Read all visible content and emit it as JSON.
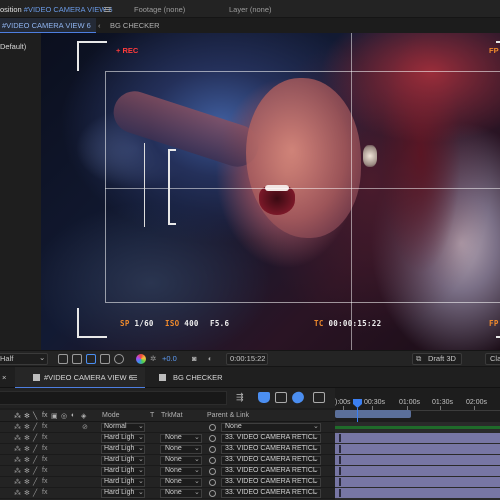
{
  "top_tabs": {
    "composition_prefix": "osition",
    "composition_name": "#VIDEO CAMERA VIEW 6",
    "footage": "Footage (none)",
    "layer": "Layer (none)"
  },
  "comp_tabs": {
    "active": "#VIDEO CAMERA VIEW 6",
    "inactive": "BG CHECKER",
    "chevron": "‹"
  },
  "left_panel": {
    "label": "Default)"
  },
  "viewfinder": {
    "rec_label": "+ REC",
    "fp_label": "FP",
    "sp_key": "SP",
    "sp_val": "1/60",
    "iso_key": "ISO",
    "iso_val": "400",
    "aperture": "F5.6",
    "tc_key": "TC",
    "tc_val": "00:00:15:22"
  },
  "viewer_toolbar": {
    "resolution": "Half",
    "exposure": "+0.0",
    "timecode": "0:00:15:22",
    "renderer": "Draft 3D",
    "cut_label": "Cla"
  },
  "timeline_tabs": {
    "active": "#VIDEO CAMERA VIEW 6",
    "inactive": "BG CHECKER"
  },
  "ruler": {
    "labels": [
      "):00s",
      "00:30s",
      "01:00s",
      "01:30s",
      "02:00s"
    ]
  },
  "columns": {
    "mode": "Mode",
    "t": "T",
    "trkmat": "TrkMat",
    "parent": "Parent & Link"
  },
  "rows": [
    {
      "mode": "Normal",
      "trkmat": "",
      "parent": "None"
    },
    {
      "mode": "Hard Ligh",
      "trkmat": "None",
      "parent": "33. VIDEO CAMERA RETICL"
    },
    {
      "mode": "Hard Ligh",
      "trkmat": "None",
      "parent": "33. VIDEO CAMERA RETICL"
    },
    {
      "mode": "Hard Ligh",
      "trkmat": "None",
      "parent": "33. VIDEO CAMERA RETICL"
    },
    {
      "mode": "Hard Ligh",
      "trkmat": "None",
      "parent": "33. VIDEO CAMERA RETICL"
    },
    {
      "mode": "Hard Ligh",
      "trkmat": "None",
      "parent": "33. VIDEO CAMERA RETICL"
    },
    {
      "mode": "Hard Ligh",
      "trkmat": "None",
      "parent": "33. VIDEO CAMERA RETICL"
    }
  ],
  "colors": {
    "accent_blue": "#3b7ff2",
    "rec_red": "#ff3b3b",
    "readout_orange": "#f08a2c",
    "layer_bar": "#7776a4"
  }
}
